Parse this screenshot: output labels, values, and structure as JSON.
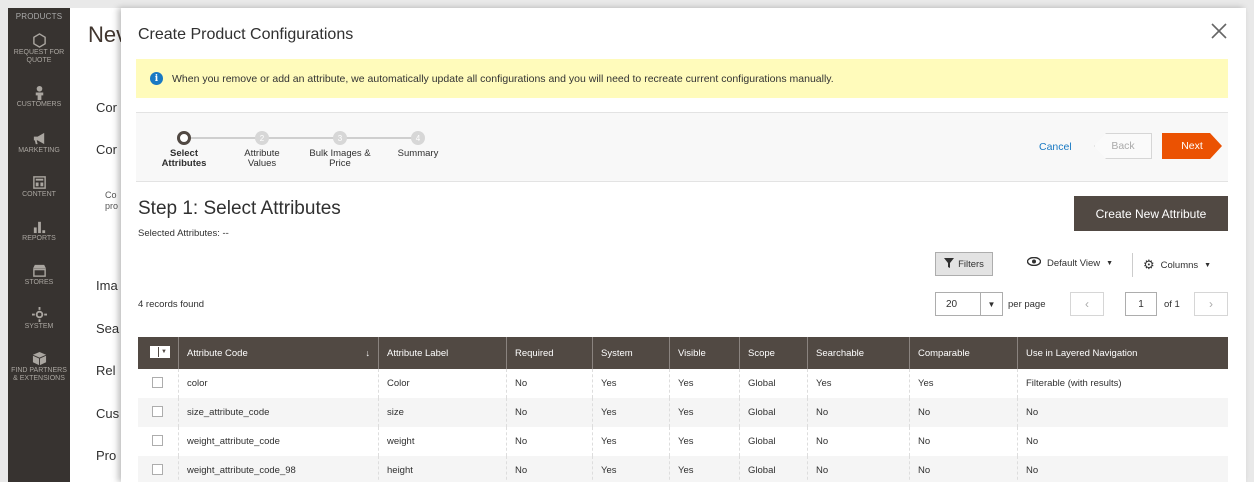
{
  "admin_nav": {
    "top_label": "PRODUCTS",
    "items": [
      {
        "label": "REQUEST FOR QUOTE",
        "icon": "hexagon-icon"
      },
      {
        "label": "CUSTOMERS",
        "icon": "person-icon"
      },
      {
        "label": "MARKETING",
        "icon": "megaphone-icon"
      },
      {
        "label": "CONTENT",
        "icon": "layout-icon"
      },
      {
        "label": "REPORTS",
        "icon": "bar-chart-icon"
      },
      {
        "label": "STORES",
        "icon": "store-icon"
      },
      {
        "label": "SYSTEM",
        "icon": "gear-icon"
      },
      {
        "label": "FIND PARTNERS & EXTENSIONS",
        "icon": "box-icon"
      }
    ]
  },
  "bg_page": {
    "title": "Nev",
    "items": [
      "Cor",
      "Cor",
      "Ima",
      "Sea",
      "Rel",
      "Cus",
      "Pro"
    ],
    "note": "Co pro"
  },
  "modal": {
    "title": "Create Product Configurations",
    "notice": "When you remove or add an attribute, we automatically update all configurations and you will need to recreate current configurations manually.",
    "steps": [
      {
        "number": "1",
        "label_line1": "Select",
        "label_line2": "Attributes",
        "active": true
      },
      {
        "number": "2",
        "label_line1": "Attribute",
        "label_line2": "Values",
        "active": false
      },
      {
        "number": "3",
        "label_line1": "Bulk Images &",
        "label_line2": "Price",
        "active": false
      },
      {
        "number": "4",
        "label_line1": "Summary",
        "label_line2": "",
        "active": false
      }
    ],
    "cancel_label": "Cancel",
    "back_label": "Back",
    "next_label": "Next",
    "step_heading": "Step 1: Select Attributes",
    "selected_attributes": "Selected Attributes: --",
    "create_new_label": "Create New Attribute"
  },
  "toolbar": {
    "filters_label": "Filters",
    "view_label": "Default View",
    "columns_label": "Columns",
    "records_found": "4 records found",
    "per_page_value": "20",
    "per_page_label": "per page",
    "current_page": "1",
    "of_pages": "of 1"
  },
  "grid": {
    "columns": [
      "Attribute Code",
      "Attribute Label",
      "Required",
      "System",
      "Visible",
      "Scope",
      "Searchable",
      "Comparable",
      "Use in Layered Navigation"
    ],
    "rows": [
      [
        "color",
        "Color",
        "No",
        "Yes",
        "Yes",
        "Global",
        "Yes",
        "Yes",
        "Filterable (with results)"
      ],
      [
        "size_attribute_code",
        "size",
        "No",
        "Yes",
        "Yes",
        "Global",
        "No",
        "No",
        "No"
      ],
      [
        "weight_attribute_code",
        "weight",
        "No",
        "Yes",
        "Yes",
        "Global",
        "No",
        "No",
        "No"
      ],
      [
        "weight_attribute_code_98",
        "height",
        "No",
        "Yes",
        "Yes",
        "Global",
        "No",
        "No",
        "No"
      ]
    ]
  },
  "colors": {
    "accent_orange": "#eb5202",
    "dark_brown": "#514943",
    "link_blue": "#1979c3",
    "notice_yellow": "#fffbbb",
    "sidebar": "#373330"
  }
}
